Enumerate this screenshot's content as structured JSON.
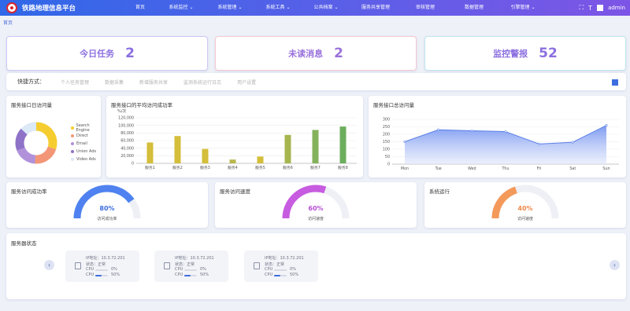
{
  "header": {
    "title": "铁路地理信息平台",
    "nav": [
      {
        "label": "首页",
        "center": 178
      },
      {
        "label": "系统监控 ⌄",
        "center": 230
      },
      {
        "label": "系统管理 ⌄",
        "center": 292
      },
      {
        "label": "系统工具 ⌄",
        "center": 353
      },
      {
        "label": "公共档案 ⌄",
        "center": 414
      },
      {
        "label": "服务共享管理",
        "center": 477
      },
      {
        "label": "审核管理",
        "center": 540
      },
      {
        "label": "数据管理",
        "center": 602
      },
      {
        "label": "引擎管理 ⌄",
        "center": 664
      }
    ],
    "user": "admin"
  },
  "breadcrumb": "首页",
  "stats": [
    {
      "label": "今日任务",
      "value": "2"
    },
    {
      "label": "未读消息",
      "value": "2"
    },
    {
      "label": "监控警报",
      "value": "52"
    }
  ],
  "quick": {
    "title": "快捷方式：",
    "links": [
      "个人任务管理",
      "数据采集",
      "新增服务共享",
      "监测系统运行日志",
      "用户设置"
    ]
  },
  "pie": {
    "title": "服务接口日访问量",
    "colors": [
      "#f5cd30",
      "#f39678",
      "#b091da",
      "#8e72c8",
      "#dce9f7"
    ],
    "legend": [
      "Search Engine",
      "Direct",
      "Email",
      "Union Ads",
      "Video Ads"
    ]
  },
  "bar_chart": {
    "title": "服务接口的平均访问成功率",
    "unit": "%/次",
    "ticks": [
      "0",
      "20,000",
      "40,000",
      "60,000",
      "80,000",
      "100,000",
      "120,000"
    ],
    "categories": [
      "服务1",
      "服务2",
      "服务3",
      "服务4",
      "服务5",
      "服务6",
      "服务7",
      "服务8"
    ],
    "values": [
      55000,
      72000,
      38000,
      10000,
      18000,
      75000,
      88000,
      97000
    ],
    "colors": [
      "#d4be3a",
      "#d4be3a",
      "#d4be3a",
      "#b9b64c",
      "#d4be3a",
      "#a7b54f",
      "#84b25c",
      "#6cae5e"
    ],
    "ymax": 120000
  },
  "line_chart": {
    "title": "服务接口总访问量",
    "ticks": [
      "0",
      "50",
      "100",
      "150",
      "200",
      "250",
      "300"
    ],
    "categories": [
      "Mon",
      "Tue",
      "Wed",
      "Thu",
      "Fri",
      "Sat",
      "Sun"
    ],
    "values": [
      150,
      230,
      224,
      218,
      135,
      147,
      260
    ],
    "ymax": 300,
    "color": "#5a7fe6"
  },
  "gauges": [
    {
      "title": "服务访问成功率",
      "percent": "80%",
      "value": 0.8,
      "sub": "访问成功率",
      "color": "#4f82f0",
      "text_color": "#3d6ee0"
    },
    {
      "title": "服务访问速度",
      "percent": "60%",
      "value": 0.6,
      "sub": "访问速度",
      "color": "#c75ce0",
      "text_color": "#b54fd6"
    },
    {
      "title": "系统运行",
      "percent": "40%",
      "value": 0.4,
      "sub": "访问速度",
      "color": "#f39a5b",
      "text_color": "#f08a4b"
    }
  ],
  "servers": {
    "title": "服务器状态",
    "items": [
      {
        "ip": "IP地址：10.3.72.201",
        "status": "状态：正常",
        "cpu_label": "CPU",
        "mem_label": "CPU",
        "cpu": "0%",
        "mem": "50%",
        "cpu_val": 0.0,
        "mem_val": 0.5
      },
      {
        "ip": "IP地址：10.3.72.201",
        "status": "状态：正常",
        "cpu_label": "CPU",
        "mem_label": "CPU",
        "cpu": "0%",
        "mem": "50%",
        "cpu_val": 0.0,
        "mem_val": 0.5
      },
      {
        "ip": "IP地址：10.3.72.201",
        "status": "状态：正常",
        "cpu_label": "CPU",
        "mem_label": "CPU",
        "cpu": "0%",
        "mem": "50%",
        "cpu_val": 0.0,
        "mem_val": 0.5
      }
    ]
  }
}
